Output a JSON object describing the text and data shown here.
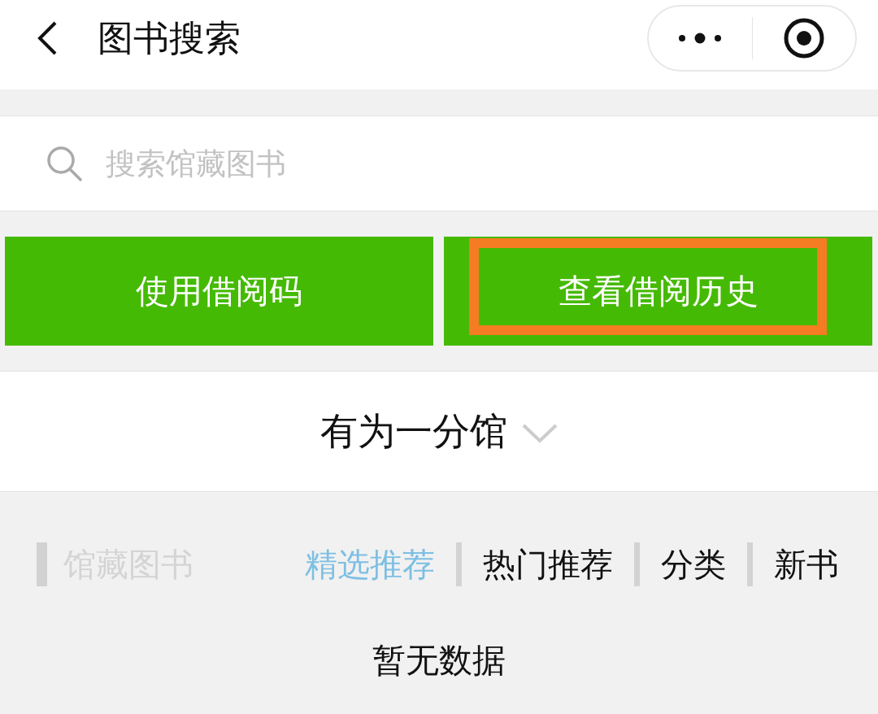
{
  "nav_bar": {
    "title": "图书搜索"
  },
  "search": {
    "placeholder": "搜索馆藏图书"
  },
  "action_buttons": [
    {
      "label": "使用借阅码",
      "highlighted": false
    },
    {
      "label": "查看借阅历史",
      "highlighted": true
    }
  ],
  "branch_selector": {
    "value": "有为一分馆"
  },
  "collection": {
    "heading": "馆藏图书",
    "tabs": [
      {
        "label": "精选推荐",
        "selected": true
      },
      {
        "label": "热门推荐",
        "selected": false
      },
      {
        "label": "分类",
        "selected": false
      },
      {
        "label": "新书",
        "selected": false
      }
    ],
    "empty_message": "暂无数据"
  }
}
